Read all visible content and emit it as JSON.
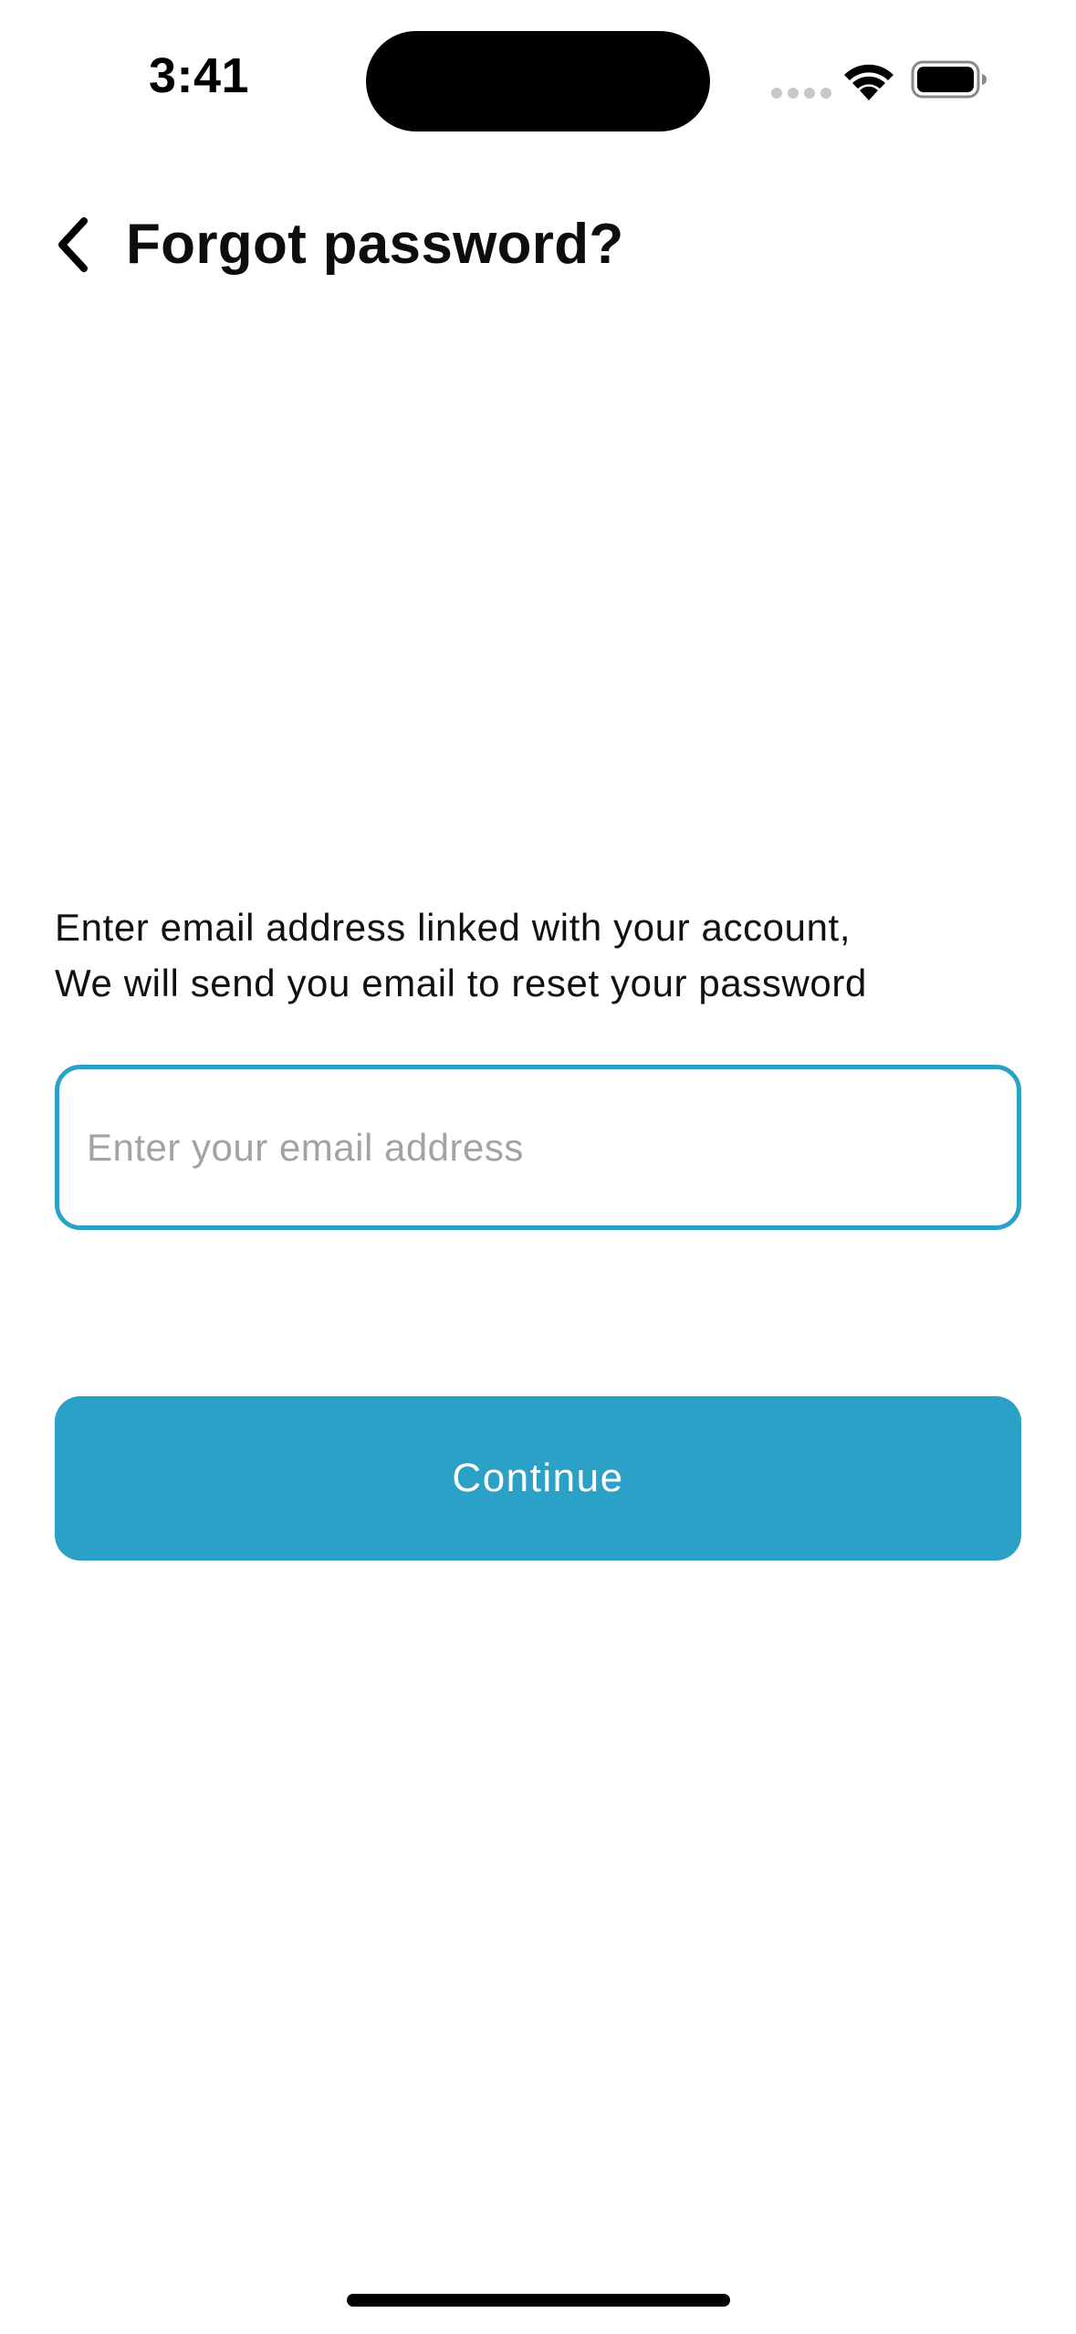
{
  "status_bar": {
    "time": "3:41"
  },
  "header": {
    "title": "Forgot password?",
    "back_icon": "chevron-left-icon"
  },
  "instructions": {
    "line1": "Enter email address linked with your account,",
    "line2": "We will send you email to reset your password"
  },
  "email": {
    "value": "",
    "placeholder": "Enter your email address"
  },
  "continue_button": {
    "label": "Continue"
  },
  "colors": {
    "accent": "#2ba1c7",
    "placeholder": "#a3a3a3",
    "text": "#111111"
  }
}
